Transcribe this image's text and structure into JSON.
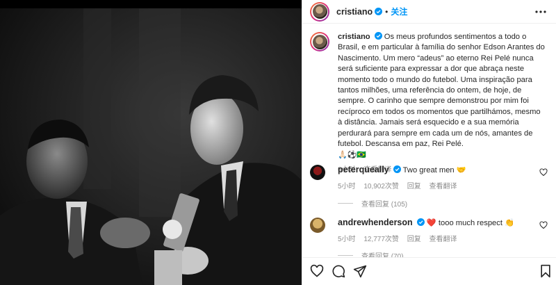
{
  "post": {
    "username": "cristiano",
    "follow_label": "关注",
    "dot": "•"
  },
  "caption": {
    "username": "cristiano",
    "text": "Os meus profundos sentimentos a todo o Brasil, e em particular à família do senhor Edson Arantes do Nascimento. Um mero “adeus” ao eterno Rei Pelé nunca será suficiente para expressar a dor que abraça neste momento todo o mundo do futebol. Uma inspiração para tantos milhões, uma referência do ontem, de hoje, de sempre. O carinho que sempre demonstrou por mim foi recíproco em todos os momentos que partilhámos, mesmo à distância. Jamais será esquecido e a sua memória perdurará para sempre em cada um de nós, amantes de futebol. Descansa em paz, Rei Pelé.",
    "emojis": "🙏🏻⚽️🇧🇷",
    "time": "6小时",
    "translate": "查看翻译"
  },
  "comments": [
    {
      "username": "peterqueally",
      "text": "Two great men 🤝",
      "time": "5小时",
      "likes": "10,902次赞",
      "reply": "回复",
      "translate": "查看翻译",
      "replies_label": "查看回复 (105)"
    },
    {
      "username": "andrewhenderson",
      "text": "❤️ tooo much respect 👏",
      "time": "5小时",
      "likes": "12,777次赞",
      "reply": "回复",
      "translate": "查看翻译",
      "replies_label": "查看回复 (70)"
    }
  ],
  "icons": {
    "like": "heart-icon",
    "comment": "comment-icon",
    "share": "share-icon",
    "save": "bookmark-icon",
    "verified": "verified-badge-icon",
    "more": "more-options-icon"
  },
  "colors": {
    "accent": "#0095f6",
    "text": "#262626",
    "muted": "#8e8e8e",
    "heart": "#ed4956"
  }
}
